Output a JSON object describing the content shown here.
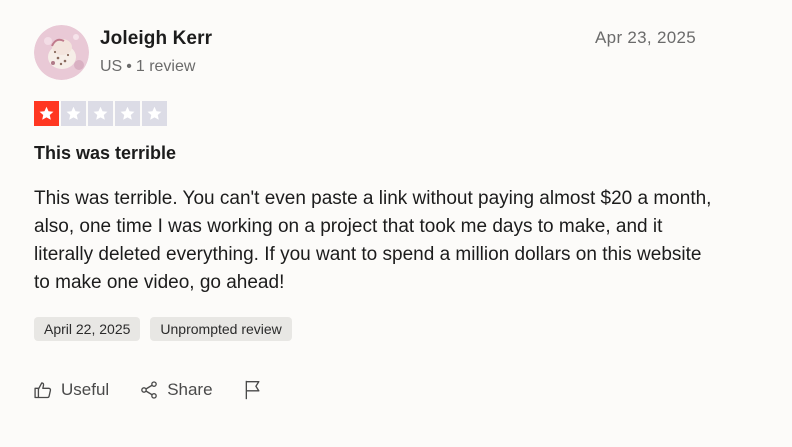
{
  "reviewer": {
    "name": "Joleigh Kerr",
    "country": "US",
    "separator": "•",
    "review_count": "1 review"
  },
  "review": {
    "date": "Apr 23, 2025",
    "rating": 1,
    "max_rating": 5,
    "title": "This was terrible",
    "body": "This was terrible. You can't even paste a link without paying almost $20 a month, also, one time I was working on a project that took me days to make, and it literally deleted everything. If you want to spend a million dollars on this website to make one video, go ahead!",
    "tags": [
      "April 22, 2025",
      "Unprompted review"
    ]
  },
  "actions": {
    "useful_label": "Useful",
    "share_label": "Share",
    "useful_icon": "thumbs-up-icon",
    "share_icon": "share-icon",
    "report_icon": "flag-icon"
  },
  "colors": {
    "star_filled": "#ff3722",
    "star_empty": "#dcdce6",
    "muted_text": "#6b6b6b",
    "tag_bg": "#e8e7e4"
  }
}
